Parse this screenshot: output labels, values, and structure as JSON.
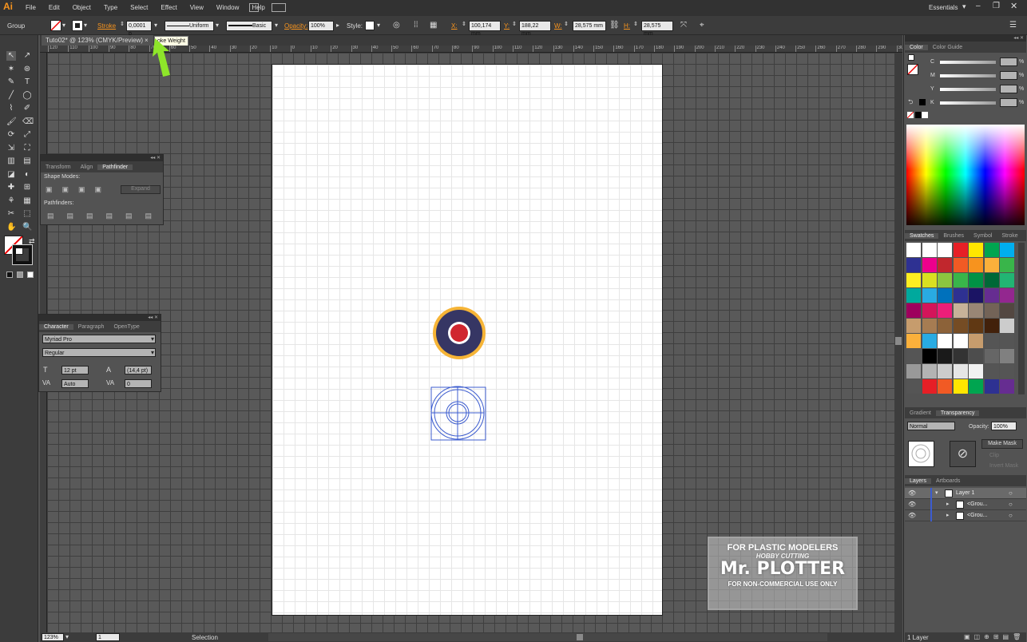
{
  "app": {
    "logo": "Ai",
    "menu": [
      "File",
      "Edit",
      "Object",
      "Type",
      "Select",
      "Effect",
      "View",
      "Window",
      "Help"
    ],
    "workspace": "Essentials"
  },
  "control": {
    "selection": "Group",
    "stroke_label": "Stroke",
    "stroke_weight": "0,0001 p",
    "profile": "Uniform",
    "brush": "Basic",
    "opacity_label": "Opacity:",
    "opacity": "100%",
    "style_label": "Style:",
    "x_label": "X:",
    "x": "100,174 mm",
    "y_label": "Y:",
    "y": "188,22 mm",
    "w_label": "W:",
    "w": "28,575 mm",
    "h_label": "H:",
    "h": "28,575 mm"
  },
  "doc": {
    "tab": "Tuto02* @ 123% (CMYK/Preview)",
    "close": "×",
    "tooltip": "oke Weight"
  },
  "ruler": {
    "h": [
      "120",
      "110",
      "100",
      "90",
      "80",
      "70",
      "60",
      "50",
      "40",
      "30",
      "20",
      "10",
      "0",
      "10",
      "20",
      "30",
      "40",
      "50",
      "60",
      "70",
      "80",
      "90",
      "100",
      "110",
      "120",
      "130",
      "140",
      "150",
      "160",
      "170",
      "180",
      "190",
      "200",
      "210",
      "220",
      "230",
      "240",
      "250",
      "260",
      "270",
      "280",
      "290",
      "300",
      "310",
      "320",
      "330"
    ]
  },
  "pathfinder": {
    "tabs": [
      "Transform",
      "Align",
      "Pathfinder"
    ],
    "shape_modes": "Shape Modes:",
    "expand": "Expand",
    "pathfinders": "Pathfinders:"
  },
  "character": {
    "tabs": [
      "Character",
      "Paragraph",
      "OpenType"
    ],
    "font": "Myriad Pro",
    "style": "Regular",
    "size": "12 pt",
    "leading": "(14,4 pt)",
    "kerning": "Auto",
    "tracking": "0"
  },
  "color": {
    "tabs": [
      "Color",
      "Color Guide"
    ],
    "channels": [
      "C",
      "M",
      "Y",
      "K"
    ],
    "unit": "%"
  },
  "swatches": {
    "tabs": [
      "Swatches",
      "Brushes",
      "Symbol",
      "Stroke"
    ],
    "rows": [
      [
        "#ffffff",
        "#ffffff",
        "#ffffff",
        "#e61f26",
        "#ffe600",
        "#00a550",
        "#00aeef"
      ],
      [
        "#2e3192",
        "#ec008c",
        "#c1272d",
        "#f15a24",
        "#f7931e",
        "#fbb03b",
        "#39b54a"
      ],
      [
        "#fcee21",
        "#d9e021",
        "#8cc63f",
        "#39b54a",
        "#009245",
        "#006837",
        "#22b573"
      ],
      [
        "#00a99d",
        "#29abe2",
        "#0071bc",
        "#2e3192",
        "#1b1464",
        "#662d91",
        "#93278f"
      ],
      [
        "#9e005d",
        "#d4145a",
        "#ed1e79",
        "#c7b299",
        "#998675",
        "#736357",
        "#534741"
      ],
      [
        "#c69c6d",
        "#a67c52",
        "#8c6239",
        "#754c24",
        "#603813",
        "#42210b",
        "#cccccc"
      ],
      [
        "#fbb03b",
        "#29abe2",
        "#ffffff",
        "#ffffff",
        "#c69c6d",
        "#555555",
        "#555555"
      ],
      [
        "#555555",
        "#000000",
        "#1a1a1a",
        "#333333",
        "#4d4d4d",
        "#666666",
        "#808080"
      ],
      [
        "#999999",
        "#b3b3b3",
        "#cccccc",
        "#e6e6e6",
        "#f2f2f2",
        "#555555",
        "#555555"
      ],
      [
        "#555555",
        "#e61f26",
        "#f15a24",
        "#ffe600",
        "#00a550",
        "#2e3192",
        "#662d91"
      ]
    ]
  },
  "transparency": {
    "tabs": [
      "Gradient",
      "Transparency"
    ],
    "mode": "Normal",
    "opacity_label": "Opacity:",
    "opacity": "100%",
    "make_mask": "Make Mask",
    "clip": "Clip",
    "invert": "Invert Mask"
  },
  "layers": {
    "tabs": [
      "Layers",
      "Artboards"
    ],
    "rows": [
      "Layer 1",
      "<Grou...",
      "<Grou..."
    ],
    "count": "1 Layer"
  },
  "status": {
    "zoom": "123%",
    "artboard": "1",
    "tool": "Selection"
  },
  "watermark": {
    "l1": "FOR PLASTIC MODELERS",
    "l2": "HOBBY CUTTING",
    "l3": "Mr. PLOTTER",
    "l4": "FOR NON-COMMERCIAL USE ONLY"
  },
  "colors": {
    "roundel_outer": "#f6b436",
    "roundel_blue": "#363664",
    "roundel_red": "#d0262f",
    "select": "#3c5ccf",
    "arrow": "#8ee62a"
  }
}
